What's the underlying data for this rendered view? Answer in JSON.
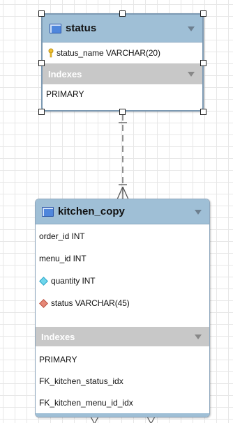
{
  "tables": {
    "status": {
      "title": "status",
      "columns": [
        {
          "label": "status_name VARCHAR(20)",
          "marker": "primary-key"
        }
      ],
      "indexes_label": "Indexes",
      "indexes": [
        "PRIMARY"
      ]
    },
    "kitchen_copy": {
      "title": "kitchen_copy",
      "columns": [
        {
          "label": "order_id INT",
          "marker": "none"
        },
        {
          "label": "menu_id INT",
          "marker": "none"
        },
        {
          "label": "quantity INT",
          "marker": "nullable"
        },
        {
          "label": "status VARCHAR(45)",
          "marker": "foreign-key"
        }
      ],
      "indexes_label": "Indexes",
      "indexes": [
        "PRIMARY",
        "FK_kitchen_status_idx",
        "FK_kitchen_menu_id_idx"
      ]
    }
  },
  "colors": {
    "header": "#9fbfd6",
    "index_header": "#c8c8c8",
    "nullable_marker": "#6fd6ec",
    "fk_marker": "#e68878",
    "key_marker": "#f2c230"
  }
}
